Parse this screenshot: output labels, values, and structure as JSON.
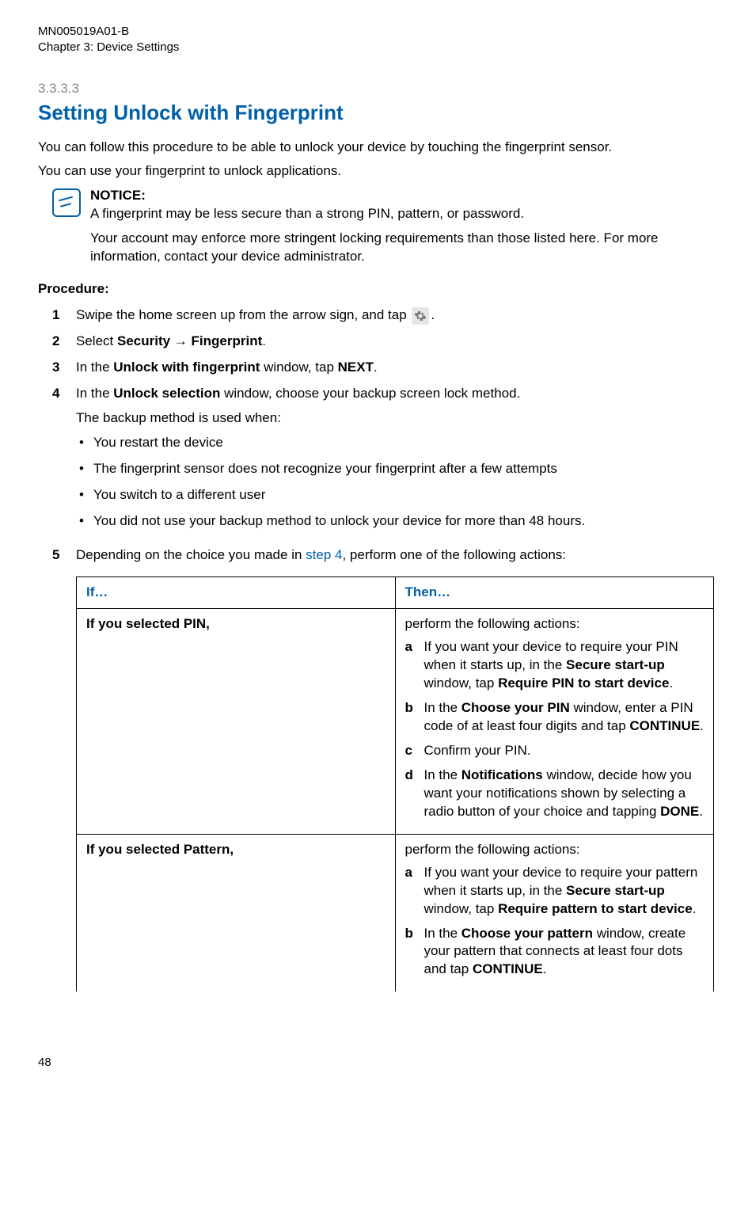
{
  "header": {
    "doc_id": "MN005019A01-B",
    "chapter": "Chapter 3:  Device Settings"
  },
  "section": {
    "number": "3.3.3.3",
    "title": "Setting Unlock with Fingerprint"
  },
  "intro": {
    "p1": "You can follow this procedure to be able to unlock your device by touching the fingerprint sensor.",
    "p2": "You can use your fingerprint to unlock applications."
  },
  "notice": {
    "label": "NOTICE:",
    "p1": "A fingerprint may be less secure than a strong PIN, pattern, or password.",
    "p2": "Your account may enforce more stringent locking requirements than those listed here. For more information, contact your device administrator."
  },
  "procedure_label": "Procedure:",
  "steps": {
    "s1_pre": "Swipe the home screen up from the arrow sign, and tap ",
    "s1_post": ".",
    "s2_pre": "Select ",
    "s2_b1": "Security",
    "s2_arrow": " → ",
    "s2_b2": "Fingerprint",
    "s2_post": ".",
    "s3_pre": "In the ",
    "s3_b1": "Unlock with fingerprint",
    "s3_mid": " window, tap ",
    "s3_b2": "NEXT",
    "s3_post": ".",
    "s4_pre": "In the ",
    "s4_b1": "Unlock selection",
    "s4_post": " window, choose your backup screen lock method.",
    "s4_sub": "The backup method is used when:",
    "s4_bullets": {
      "b1": "You restart the device",
      "b2": "The fingerprint sensor does not recognize your fingerprint after a few attempts",
      "b3": "You switch to a different user",
      "b4": "You did not use your backup method to unlock your device for more than 48 hours."
    },
    "s5_pre": "Depending on the choice you made in ",
    "s5_link": "step 4",
    "s5_post": ", perform one of the following actions:"
  },
  "table": {
    "h_if": "If…",
    "h_then": "Then…",
    "row1": {
      "if": "If you selected PIN,",
      "then_intro": "perform the following actions:",
      "a_pre": "If you want your device to require your PIN when it starts up, in the ",
      "a_b1": "Secure start-up",
      "a_mid": " window, tap ",
      "a_b2": "Require PIN to start device",
      "a_post": ".",
      "b_pre": "In the ",
      "b_b1": "Choose your PIN",
      "b_mid": " window, enter a PIN code of at least four digits and tap ",
      "b_b2": "CONTINUE",
      "b_post": ".",
      "c": "Confirm your PIN.",
      "d_pre": "In the ",
      "d_b1": "Notifications",
      "d_mid": " window, decide how you want your notifications shown by selecting a radio button of your choice and tapping ",
      "d_b2": "DONE",
      "d_post": "."
    },
    "row2": {
      "if": "If you selected Pattern,",
      "then_intro": "perform the following actions:",
      "a_pre": "If you want your device to require your pattern when it starts up, in the ",
      "a_b1": "Secure start-up",
      "a_mid": " window, tap ",
      "a_b2": "Require pattern to start device",
      "a_post": ".",
      "b_pre": "In the ",
      "b_b1": "Choose your pattern",
      "b_mid": " window, create your pattern that connects at least four dots and tap ",
      "b_b2": "CONTINUE",
      "b_post": "."
    }
  },
  "footer": {
    "page": "48"
  },
  "letters": {
    "a": "a",
    "b": "b",
    "c": "c",
    "d": "d"
  },
  "nums": {
    "n1": "1",
    "n2": "2",
    "n3": "3",
    "n4": "4",
    "n5": "5"
  }
}
